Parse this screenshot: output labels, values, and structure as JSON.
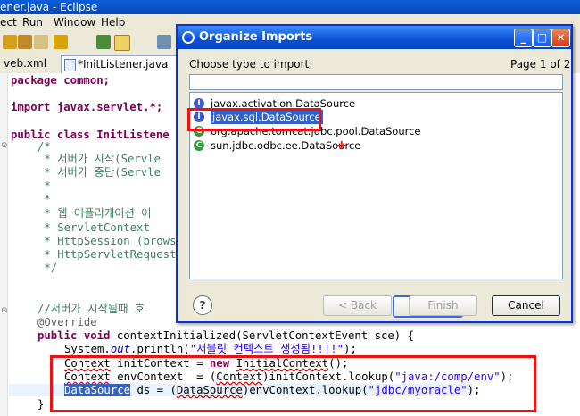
{
  "window": {
    "title": "ener.java - Eclipse"
  },
  "menu": [
    "ect",
    "Run",
    "Window",
    "Help"
  ],
  "tabs": [
    {
      "label": "veb.xml"
    },
    {
      "label": "*InitListener.java"
    }
  ],
  "code": {
    "l1": "package common;",
    "l2": "import javax.servlet.*;",
    "l3": "public class InitListene",
    "c1": "/*",
    "c2": " * 서버가 시작(Servle",
    "c3": " * 서버가 중단(Servle",
    "c4": " *",
    "c5": " *",
    "c6": " * 웹 어플리케이션 어",
    "c7": " * ServletContext",
    "c8": " * HttpSession (brows",
    "c9": " * HttpServletRequest",
    "c10": " */",
    "c11": "//서버가 시작될때 호",
    "ann": "@Override",
    "m_pre": "public void ",
    "m_name": "contextInitialized(ServletContextEvent sce) {",
    "p_pre": "System.",
    "p_out": "out",
    "p_mid": ".println(",
    "p_str": "\"서블릿 컨텍스트 생성됨!!!!\"",
    "p_end": ");",
    "a_type": "Context",
    "a_mid": " initContext = ",
    "a_new": "new",
    "a_cls": "InitialContext",
    "a_end": "();",
    "b_type": "Context",
    "b_mid": " envContext  = (",
    "b_cast": "Context",
    "b_call": ")initContext.lookup(",
    "b_str": "\"java:/comp/env\"",
    "b_end": ");",
    "d_type": "DataSource",
    "d_mid": " ds = (",
    "d_cast": "DataSource",
    "d_call": ")envContext.lookup(",
    "d_str": "\"jdbc/myoracle\"",
    "d_end": ");",
    "close": "}"
  },
  "dialog": {
    "title": "Organize Imports",
    "prompt": "Choose type to import:",
    "page": "Page 1 of 2",
    "filter_value": "",
    "items": [
      {
        "label": "javax.activation.DataSource",
        "icon": "interface-icon",
        "color": "#3f5ccc"
      },
      {
        "label": "javax.sql.DataSource",
        "icon": "interface-icon",
        "color": "#3f5ccc",
        "selected": true
      },
      {
        "label": "org.apache.tomcat.jdbc.pool.DataSource",
        "icon": "class-icon",
        "color": "#2e9a3a"
      },
      {
        "label": "sun.jdbc.odbc.ee.DataSource",
        "icon": "class-icon",
        "color": "#2e9a3a"
      }
    ],
    "buttons": {
      "back": "< Back",
      "next": "Next >",
      "finish": "Finish",
      "cancel": "Cancel"
    },
    "help": "?"
  },
  "colors": {
    "selection": "#3163c6",
    "annotation_box": "#ee1111",
    "keyword": "#7f0055",
    "comment": "#3f7f5f",
    "string": "#2a00ff"
  }
}
